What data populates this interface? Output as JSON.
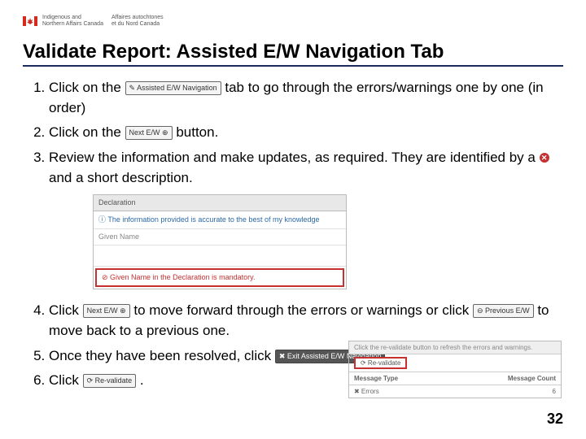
{
  "header": {
    "dept_en_line1": "Indigenous and",
    "dept_en_line2": "Northern Affairs Canada",
    "dept_fr_line1": "Affaires autochtones",
    "dept_fr_line2": "et du Nord Canada"
  },
  "title": "Validate Report: Assisted E/W Navigation Tab",
  "buttons": {
    "assisted_tab": "✎ Assisted E/W Navigation",
    "next_ew": "Next E/W ⊕",
    "next_ew2": "Next E/W ⊕",
    "prev_ew": "⊖ Previous E/W",
    "exit_nav": "✖ Exit Assisted E/W Navigation",
    "revalidate": "⟳ Re-validate",
    "revalidate_box": "⟳ Re-validate"
  },
  "steps": {
    "s1a": "Click on the ",
    "s1b": " tab to go through the errors/warnings one by one (in order)",
    "s2a": "Click on the ",
    "s2b": " button.",
    "s3a": "Review the information and make updates, as required. They are identified by a ",
    "s3b": " and a short description.",
    "s4a": "Click ",
    "s4b": " to move forward through the errors or warnings or click ",
    "s4c": " to move back to a previous one.",
    "s5a": "Once they have been resolved, click ",
    "s5b": ".",
    "s6a": "Click ",
    "s6b": "."
  },
  "screenshot1": {
    "header": "Declaration",
    "info": "The information provided is accurate to the best of my knowledge",
    "label": "Given Name",
    "error": "Given Name in the Declaration is mandatory."
  },
  "screenshot2": {
    "hint": "Click the re-validate button to refresh the errors and warnings.",
    "col1": "Message Type",
    "col2": "Message Count",
    "row_label": "✖ Errors",
    "row_val": "6"
  },
  "page_number": "32"
}
